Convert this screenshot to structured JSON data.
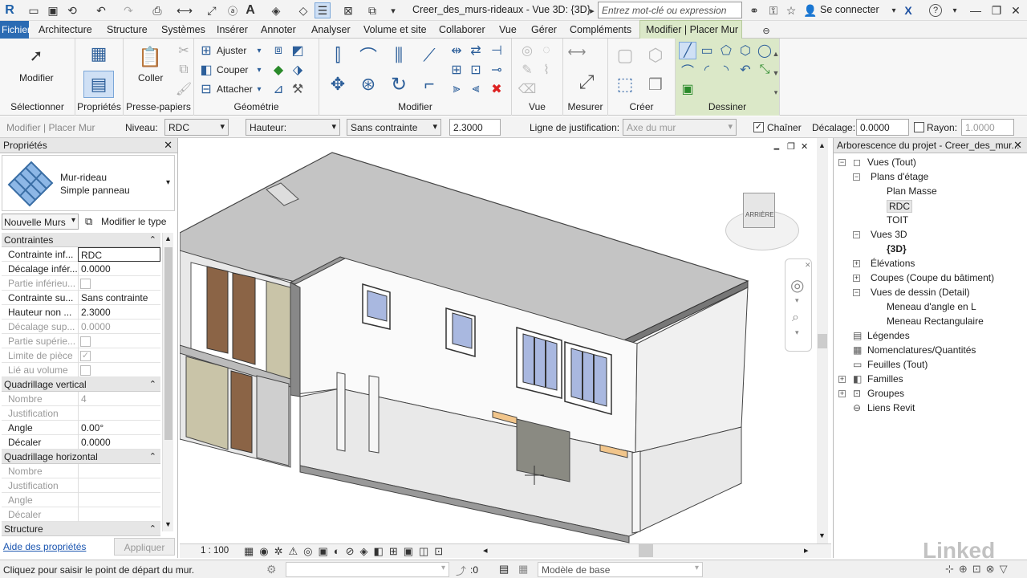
{
  "titlebar": {
    "title": "Creer_des_murs-rideaux - Vue 3D: {3D}",
    "search_placeholder": "Entrez mot-clé ou expression",
    "signin": "Se connecter",
    "help": "?"
  },
  "menu": {
    "file": "Fichier",
    "items": [
      "Architecture",
      "Structure",
      "Systèmes",
      "Insérer",
      "Annoter",
      "Analyser",
      "Volume et site",
      "Collaborer",
      "Vue",
      "Gérer",
      "Compléments",
      "Modifier | Placer Mur"
    ]
  },
  "ribbon": {
    "panels": [
      "Sélectionner",
      "Propriétés",
      "Presse-papiers",
      "Géométrie",
      "Modifier",
      "Vue",
      "Mesurer",
      "Créer",
      "Dessiner"
    ],
    "modify_label": "Modifier",
    "paste_label": "Coller",
    "geometry_buttons": [
      "Ajuster",
      "Couper",
      "Attacher"
    ]
  },
  "options_bar": {
    "context": "Modifier | Placer Mur",
    "level_label": "Niveau:",
    "level_value": "RDC",
    "height_value": "Hauteur:",
    "constraint_value": "Sans contrainte",
    "height_number": "2.3000",
    "justification_label": "Ligne de justification:",
    "justification_value": "Axe du mur",
    "chain_label": "Chaîner",
    "offset_label": "Décalage:",
    "offset_value": "0.0000",
    "radius_label": "Rayon:",
    "radius_value": "1.0000"
  },
  "properties": {
    "title": "Propriétés",
    "type_line1": "Mur-rideau",
    "type_line2": "Simple panneau",
    "instance_select": "Nouvelle Murs",
    "edit_type": "Modifier le type",
    "groups": [
      {
        "name": "Contraintes",
        "rows": [
          {
            "k": "Contrainte inf...",
            "v": "RDC"
          },
          {
            "k": "Décalage infér...",
            "v": "0.0000"
          },
          {
            "k": "Partie inférieu...",
            "v": ""
          },
          {
            "k": "Contrainte su...",
            "v": "Sans contrainte"
          },
          {
            "k": "Hauteur non ...",
            "v": "2.3000"
          },
          {
            "k": "Décalage sup...",
            "v": "0.0000"
          },
          {
            "k": "Partie supérie...",
            "v": ""
          },
          {
            "k": "Limite de pièce",
            "v": ""
          },
          {
            "k": "Lié au volume",
            "v": ""
          }
        ]
      },
      {
        "name": "Quadrillage vertical",
        "rows": [
          {
            "k": "Nombre",
            "v": "4"
          },
          {
            "k": "Justification",
            "v": ""
          },
          {
            "k": "Angle",
            "v": "0.00°"
          },
          {
            "k": "Décaler",
            "v": "0.0000"
          }
        ]
      },
      {
        "name": "Quadrillage horizontal",
        "rows": [
          {
            "k": "Nombre",
            "v": ""
          },
          {
            "k": "Justification",
            "v": ""
          },
          {
            "k": "Angle",
            "v": ""
          },
          {
            "k": "Décaler",
            "v": ""
          }
        ]
      },
      {
        "name": "Structure",
        "rows": []
      }
    ],
    "help_link": "Aide des propriétés",
    "apply": "Appliquer"
  },
  "viewcube": {
    "face": "ARRIÈRE"
  },
  "view_controls": {
    "scale": "1 : 100"
  },
  "browser": {
    "title": "Arborescence du projet - Creer_des_mur...",
    "nodes": [
      "Vues (Tout)",
      "Plans d'étage",
      "Plan Masse",
      "RDC",
      "TOIT",
      "Vues 3D",
      "{3D}",
      "Élévations",
      "Coupes (Coupe du bâtiment)",
      "Vues de dessin (Detail)",
      "Meneau d'angle en L",
      "Meneau Rectangulaire",
      "Légendes",
      "Nomenclatures/Quantités",
      "Feuilles (Tout)",
      "Familles",
      "Groupes",
      "Liens Revit"
    ]
  },
  "status": {
    "message": "Cliquez pour saisir le point de départ du mur.",
    "coord": ":0",
    "model": "Modèle de base",
    "watermark": "Linked"
  },
  "colors": {
    "accent": "#2b6bb3",
    "ribbon_active": "#dbe8c8"
  }
}
